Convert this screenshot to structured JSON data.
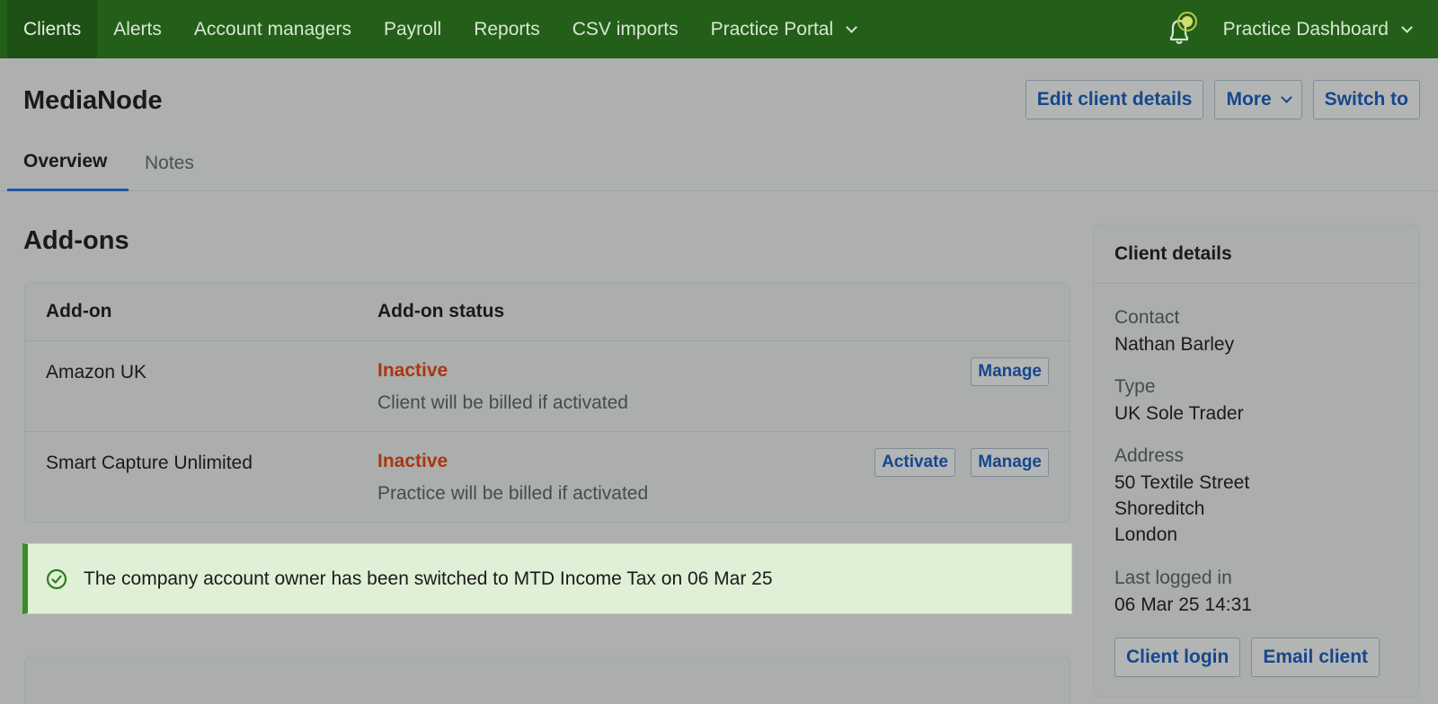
{
  "nav": {
    "items": [
      {
        "label": "Clients"
      },
      {
        "label": "Alerts"
      },
      {
        "label": "Account managers"
      },
      {
        "label": "Payroll"
      },
      {
        "label": "Reports"
      },
      {
        "label": "CSV imports"
      },
      {
        "label": "Practice Portal"
      }
    ],
    "dashboard_label": "Practice Dashboard",
    "bell_icon": "bell-icon"
  },
  "header": {
    "client_name": "MediaNode",
    "edit_label": "Edit client details",
    "more_label": "More",
    "switch_label": "Switch to"
  },
  "tabs": {
    "overview": "Overview",
    "notes": "Notes"
  },
  "addons": {
    "title": "Add-ons",
    "col_addon": "Add-on",
    "col_status": "Add-on status",
    "rows": [
      {
        "name": "Amazon UK",
        "status": "Inactive",
        "note": "Client will be billed if activated",
        "manage": "Manage"
      },
      {
        "name": "Smart Capture Unlimited",
        "status": "Inactive",
        "note": "Practice will be billed if activated",
        "activate": "Activate",
        "manage": "Manage"
      }
    ]
  },
  "banner": {
    "text": "The company account owner has been switched to MTD Income Tax on 06 Mar 25",
    "icon": "check-circle-icon"
  },
  "client_details": {
    "title": "Client details",
    "contact_label": "Contact",
    "contact_value": "Nathan Barley",
    "type_label": "Type",
    "type_value": "UK Sole Trader",
    "address_label": "Address",
    "address_line1": "50 Textile Street",
    "address_line2": "Shoreditch",
    "address_line3": "London",
    "last_logged_label": "Last logged in",
    "last_logged_value": "06 Mar 25 14:31",
    "client_login_label": "Client login",
    "email_client_label": "Email client"
  },
  "colors": {
    "nav_bg": "#235f19",
    "link_blue": "#16478c",
    "inactive_red": "#a8380f",
    "success_bg": "#dff0d6",
    "success_border": "#3a8a25"
  }
}
